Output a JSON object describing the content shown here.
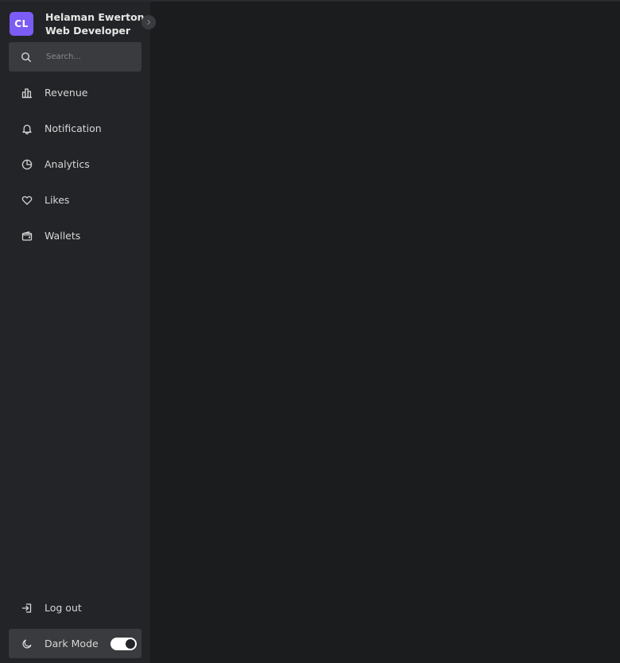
{
  "profile": {
    "avatar_initials": "CL",
    "name": "Helaman Ewerton",
    "role": "Web Developer"
  },
  "search": {
    "placeholder": "Search..."
  },
  "nav": {
    "items": [
      {
        "label": "Revenue",
        "icon": "bar-chart-icon"
      },
      {
        "label": "Notification",
        "icon": "bell-icon"
      },
      {
        "label": "Analytics",
        "icon": "pie-chart-icon"
      },
      {
        "label": "Likes",
        "icon": "heart-icon"
      },
      {
        "label": "Wallets",
        "icon": "wallet-icon"
      }
    ]
  },
  "footer": {
    "logout_label": "Log out",
    "dark_mode_label": "Dark Mode",
    "dark_mode_enabled": true
  },
  "colors": {
    "accent": "#7b5cf5",
    "sidebar_bg": "#232427",
    "page_bg": "#1b1c1e"
  }
}
